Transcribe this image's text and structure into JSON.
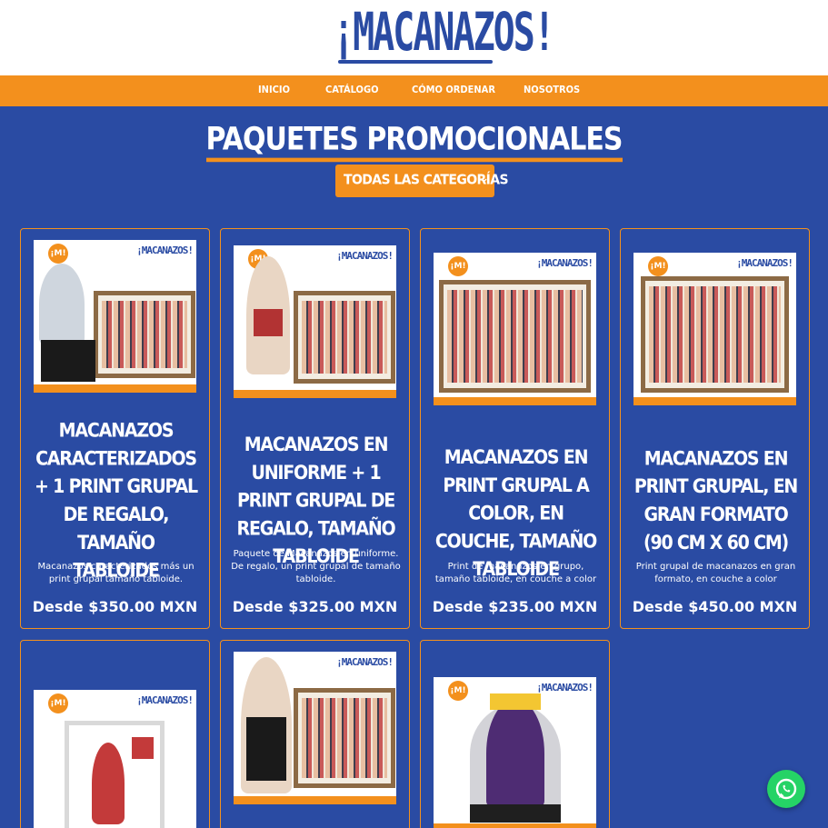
{
  "header": {
    "logo_text": "¡MACANAZOS!"
  },
  "nav": {
    "items": [
      "INICIO",
      "CATÁLOGO",
      "CÓMO ORDENAR",
      "NOSOTROS"
    ]
  },
  "page": {
    "title": "PAQUETES PROMOCIONALES"
  },
  "filter": {
    "label": "TODAS LAS CATEGORÍAS",
    "chevron": "chevron-down-icon"
  },
  "thumbnail": {
    "brand": "¡MACANAZOS!",
    "badge": "¡M!"
  },
  "cards": [
    {
      "title": "MACANAZOS CARACTERIZADOS + 1 PRINT GRUPAL DE REGALO, TAMAÑO TABLOIDE",
      "description": "Macanazos caracterizados más un print grupal tamaño tabloide.",
      "price": "Desde $350.00 MXN"
    },
    {
      "title": "MACANAZOS EN UNIFORME + 1 PRINT GRUPAL DE REGALO, TAMAÑO TABLOIDE",
      "description": "Paquete de Macanazos en uniforme. De regalo, un print grupal de tamaño tabloide.",
      "price": "Desde $325.00 MXN"
    },
    {
      "title": "MACANAZOS EN PRINT GRUPAL A COLOR, EN COUCHE, TAMAÑO TABLOIDE",
      "description": "Print de macanazos en grupo, tamaño tabloide, en couche a color",
      "price": "Desde $235.00 MXN"
    },
    {
      "title": "MACANAZOS EN PRINT GRUPAL, EN GRAN FORMATO (90 CM X 60 CM)",
      "description": "Print grupal de macanazos en gran formato, en couche a color",
      "price": "Desde $450.00 MXN"
    },
    {
      "title": "",
      "description": "",
      "price": ""
    },
    {
      "title": "",
      "description": "",
      "price": ""
    },
    {
      "title": "",
      "description": "",
      "price": ""
    }
  ],
  "colors": {
    "brand_blue": "#2a4ba3",
    "accent_orange": "#f3901d",
    "whatsapp_green": "#25d366"
  },
  "icons": {
    "whatsapp": "whatsapp-icon"
  }
}
